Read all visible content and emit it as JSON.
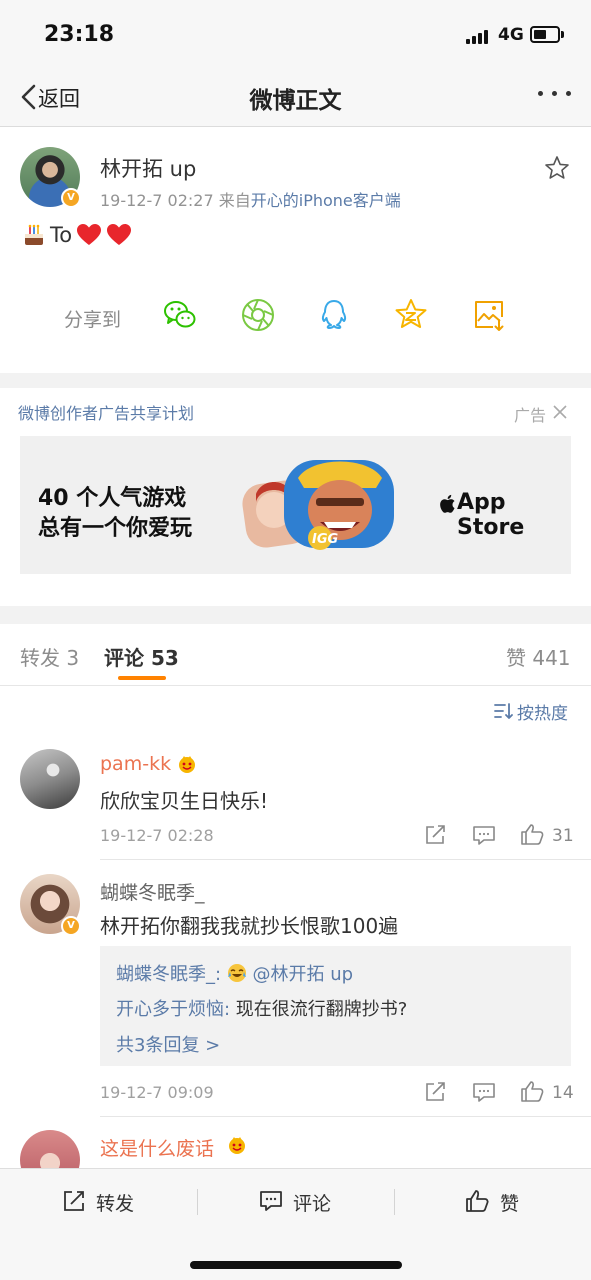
{
  "status_bar": {
    "time": "23:18",
    "network": "4G"
  },
  "nav": {
    "back_label": "返回",
    "title": "微博正文"
  },
  "post": {
    "author": "林开拓 up",
    "timestamp": "19-12-7 02:27",
    "source_prefix": "来自",
    "source": "开心的iPhone客户端",
    "text": "To",
    "share_label": "分享到",
    "share_icons": [
      "wechat-icon",
      "moments-icon",
      "qq-icon",
      "qzone-icon",
      "save-image-icon"
    ]
  },
  "ad": {
    "title": "微博创作者广告共享计划",
    "label": "广告",
    "line1": "40 个人气游戏",
    "line2": "总有一个你爱玩",
    "store": "App Store",
    "art_label": "IGG"
  },
  "tabs": {
    "repost": "转发 3",
    "comment": "评论 53",
    "likes": "赞 441"
  },
  "sort_label": "按热度",
  "comments": [
    {
      "name": "pam-kk",
      "text": "欣欣宝贝生日快乐!",
      "time": "19-12-7 02:28",
      "likes": "31"
    },
    {
      "name": "蝴蝶冬眠季_",
      "text": "林开拓你翻我我就抄长恨歌100遍",
      "time": "19-12-7 09:09",
      "likes": "14",
      "replies": {
        "line1_name": "蝴蝶冬眠季_:",
        "line1_mention": "@林开拓 up",
        "line2_name": "开心多于烦恼:",
        "line2_text": " 现在很流行翻牌抄书?",
        "more": "共3条回复 >"
      }
    },
    {
      "name": "这是什么废话"
    }
  ],
  "bottom_bar": {
    "repost": "转发",
    "comment": "评论",
    "like": "赞"
  },
  "colors": {
    "accent_orange": "#ff8200",
    "link_blue": "#5b7ba8",
    "name_orange": "#eb7350"
  }
}
